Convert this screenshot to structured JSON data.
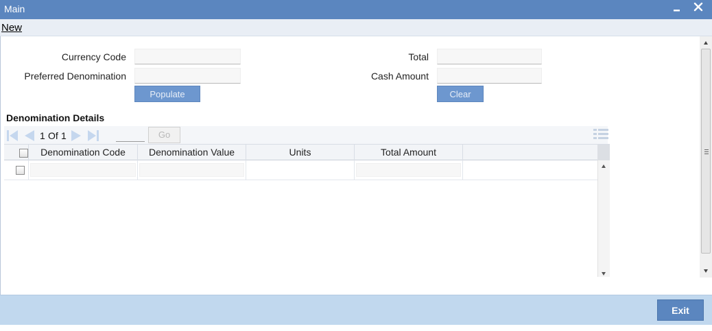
{
  "window": {
    "title": "Main"
  },
  "menu": {
    "new_label": "New"
  },
  "form": {
    "currency_code_label": "Currency Code",
    "currency_code_value": "",
    "preferred_denomination_label": "Preferred Denomination",
    "preferred_denomination_value": "",
    "total_label": "Total",
    "total_value": "",
    "cash_amount_label": "Cash Amount",
    "cash_amount_value": "",
    "populate_label": "Populate",
    "clear_label": "Clear"
  },
  "denomination": {
    "section_title": "Denomination Details",
    "pagination": {
      "current": "1",
      "of": "Of",
      "total": "1",
      "go_label": "Go"
    },
    "columns": [
      "Denomination Code",
      "Denomination Value",
      "Units",
      "Total Amount"
    ],
    "rows": [
      {
        "denomination_code": "",
        "denomination_value": "",
        "units": "",
        "total_amount": ""
      }
    ]
  },
  "footer": {
    "exit_label": "Exit"
  },
  "colors": {
    "titlebar": "#5b86bf",
    "button": "#6d97cf",
    "footer": "#c1d8ee"
  },
  "icons": [
    "minimize-icon",
    "close-icon",
    "first-page-icon",
    "previous-page-icon",
    "next-page-icon",
    "last-page-icon",
    "columns-icon"
  ]
}
